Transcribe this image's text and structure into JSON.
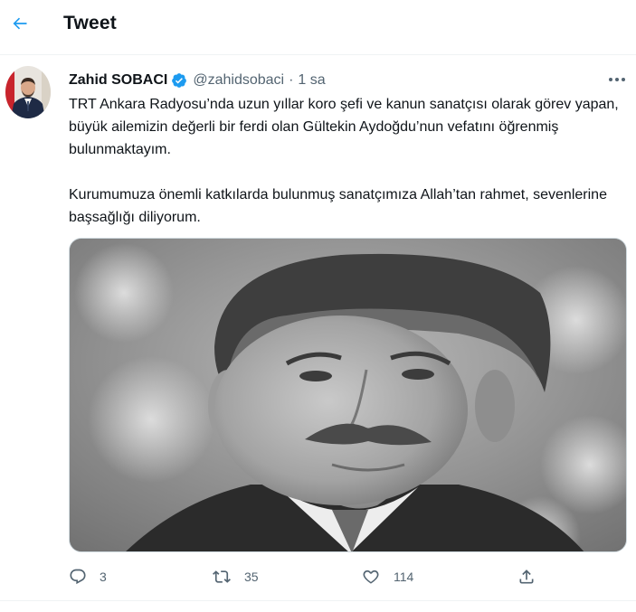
{
  "header": {
    "title": "Tweet",
    "back_icon": "arrow-left-icon"
  },
  "tweet": {
    "author": {
      "name": "Zahid SOBACI",
      "handle": "@zahidsobaci",
      "verified": true
    },
    "separator": "·",
    "time": "1 sa",
    "paragraphs": [
      "TRT Ankara Radyosu’nda uzun yıllar koro şefi ve kanun sanatçısı olarak görev yapan, büyük ailemizin değerli bir ferdi olan Gültekin Aydoğdu’nun vefatını öğrenmiş bulunmaktayım.",
      "Kurumumuza önemli katkılarda bulunmuş sanatçımıza Allah’tan rahmet, sevenlerine başsağlığı diliyorum."
    ],
    "media": {
      "kind": "photo",
      "style": "black-and-white portrait"
    },
    "actions": {
      "reply": {
        "icon": "reply-icon",
        "count": "3"
      },
      "retweet": {
        "icon": "retweet-icon",
        "count": "35"
      },
      "like": {
        "icon": "heart-icon",
        "count": "114"
      },
      "share": {
        "icon": "share-icon"
      }
    }
  },
  "colors": {
    "accent": "#1d9bf0",
    "text": "#0f1419",
    "secondary": "#536471",
    "divider": "#eff3f4"
  }
}
